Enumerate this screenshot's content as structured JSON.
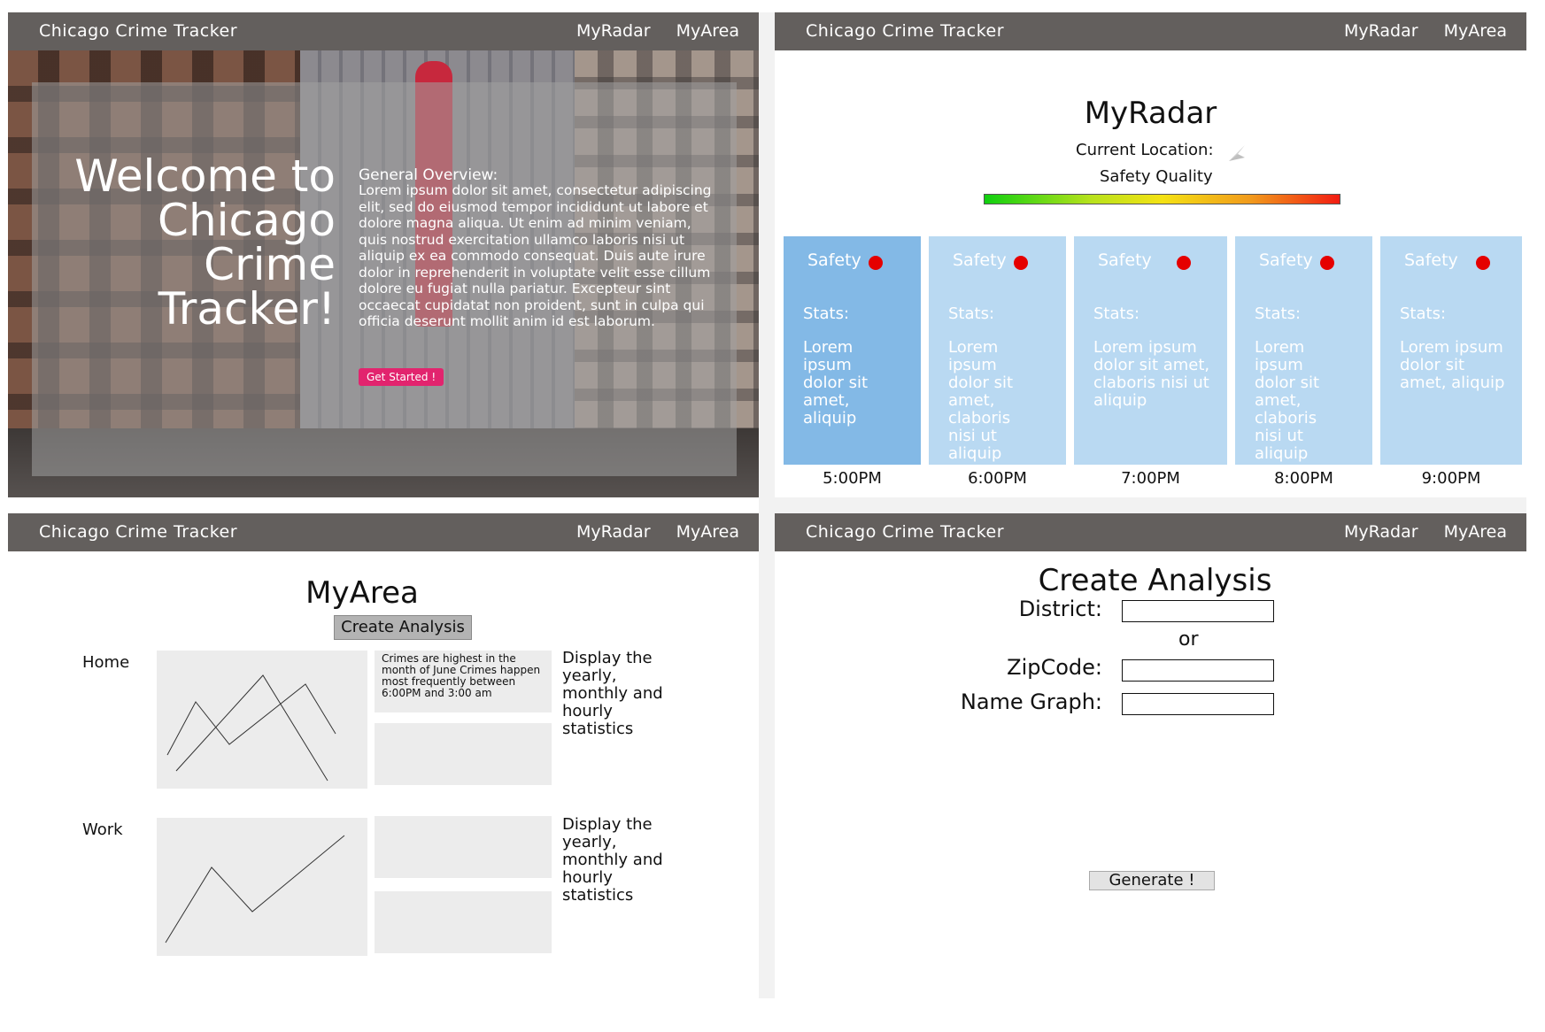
{
  "nav": {
    "brand": "Chicago Crime Tracker",
    "link_radar": "MyRadar",
    "link_area": "MyArea"
  },
  "home": {
    "welcome_line1": "Welcome to",
    "welcome_line2": "Chicago",
    "welcome_line3": "Crime",
    "welcome_line4": "Tracker!",
    "overview_title": "General Overview:",
    "overview_body": "Lorem ipsum dolor sit amet, consectetur adipiscing elit, sed do eiusmod tempor incididunt ut labore et dolore magna aliqua. Ut enim ad minim veniam, quis nostrud exercitation ullamco laboris nisi ut aliquip ex ea commodo consequat. Duis aute irure dolor in reprehenderit in voluptate velit esse cillum dolore eu fugiat nulla pariatur. Excepteur sint occaecat cupidatat non proident, sunt in culpa qui officia deserunt mollit anim id est laborum.",
    "get_started": "Get Started !"
  },
  "radar": {
    "title": "MyRadar",
    "current_location_label": "Current Location:",
    "safety_quality_label": "Safety Quality",
    "cards": [
      {
        "safety": "Safety",
        "stats": "Stats:",
        "desc": "Lorem ipsum dolor sit amet, aliquip",
        "time": "5:00PM"
      },
      {
        "safety": "Safety",
        "stats": "Stats:",
        "desc": "Lorem ipsum dolor sit amet, claboris nisi ut aliquip",
        "time": "6:00PM"
      },
      {
        "safety": "Safety",
        "stats": "Stats:",
        "desc": "Lorem ipsum dolor sit amet, claboris nisi ut aliquip",
        "time": "7:00PM"
      },
      {
        "safety": "Safety",
        "stats": "Stats:",
        "desc": "Lorem ipsum dolor sit amet, claboris nisi ut aliquip",
        "time": "8:00PM"
      },
      {
        "safety": "Safety",
        "stats": "Stats:",
        "desc": "Lorem ipsum dolor sit amet, aliquip",
        "time": "9:00PM"
      }
    ],
    "colors": {
      "safety_dot": "#e50000",
      "card_active": "#83b9e6",
      "card": "#b9d9f2"
    }
  },
  "area": {
    "title": "MyArea",
    "create_analysis": "Create Analysis",
    "rows": [
      {
        "label": "Home",
        "info": "Crimes are highest in the month of June Crimes happen most frequently between 6:00PM and 3:00 am",
        "stat_text": "Display the yearly, monthly and hourly statistics"
      },
      {
        "label": "Work",
        "info": "",
        "stat_text": "Display the yearly, monthly and hourly statistics"
      }
    ]
  },
  "create": {
    "title": "Create Analysis",
    "district_label": "District:",
    "or_label": "or",
    "zipcode_label": "ZipCode:",
    "name_graph_label": "Name Graph:",
    "district_value": "",
    "zipcode_value": "",
    "name_graph_value": "",
    "generate": "Generate !"
  }
}
